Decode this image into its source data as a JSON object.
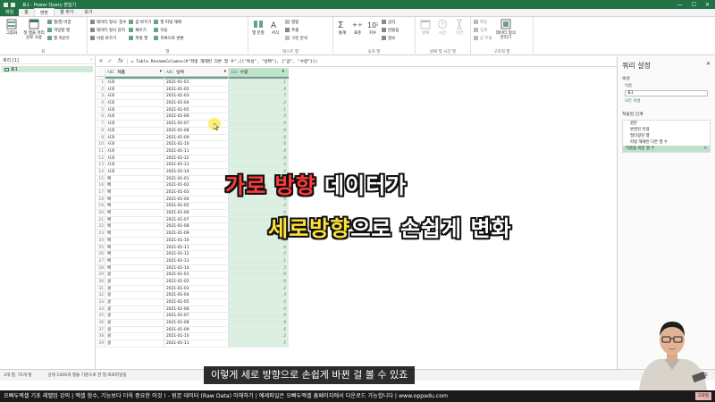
{
  "window": {
    "title": "표1 - Power Query 편집기"
  },
  "tabs": [
    {
      "label": "파일",
      "kind": "file"
    },
    {
      "label": "홈",
      "kind": ""
    },
    {
      "label": "변환",
      "kind": "active"
    },
    {
      "label": "열 추가",
      "kind": ""
    },
    {
      "label": "보기",
      "kind": ""
    }
  ],
  "ribbon": {
    "group_table": {
      "label": "표",
      "big1": "그룹화",
      "big2": "첫 행을 머리글로 사용",
      "small": [
        "행/열 바꿈",
        "역방향 행",
        "행 카운트"
      ]
    },
    "group_anycol": {
      "label": "열",
      "small1": [
        "데이터 형식: 정수",
        "데이터 형식 감지",
        "이름 바꾸기"
      ],
      "small2": [
        "값 바꾸기",
        "채우기",
        "피벗 열"
      ],
      "small3": [
        "열 피벗 해제",
        "이동",
        "목록으로 변환"
      ]
    },
    "group_text": {
      "label": "텍스트 열",
      "big1": "열 분할",
      "big2": "서식",
      "small": [
        "병합",
        "추출",
        "구문 분석"
      ]
    },
    "group_number": {
      "label": "숫자 열",
      "big1": "통계",
      "big2": "표준",
      "big3": "지수",
      "small": [
        "삼각",
        "반올림",
        "정보"
      ]
    },
    "group_datetime": {
      "label": "날짜 및 시간 열",
      "big1": "날짜",
      "big2": "시간",
      "big3": "기간"
    },
    "group_structured": {
      "label": "구조적 열",
      "small": [
        "확장",
        "집계",
        "값 추출"
      ],
      "big1": "데이터 형식 관리기"
    }
  },
  "queries": {
    "header": "쿼리 [1]",
    "items": [
      {
        "label": "표1"
      }
    ]
  },
  "formula": {
    "cancel": "✕",
    "confirm": "✓",
    "fx": "fx",
    "text": "= Table.RenameColumns(#\"피벗 해제된 다른 열 수\",{{\"특성\", \"날짜\"}, {\"값\", \"수량\"}})"
  },
  "grid": {
    "columns": [
      {
        "label": "제품",
        "type": "ABC"
      },
      {
        "label": "날짜",
        "type": "ABC"
      },
      {
        "label": "수량",
        "type": "123"
      }
    ],
    "rows": [
      [
        "1",
        "사과",
        "2021-01-01",
        "1"
      ],
      [
        "2",
        "사과",
        "2021-01-02",
        "6"
      ],
      [
        "3",
        "사과",
        "2021-01-03",
        "7"
      ],
      [
        "4",
        "사과",
        "2021-01-04",
        "2"
      ],
      [
        "5",
        "사과",
        "2021-01-05",
        "1"
      ],
      [
        "6",
        "사과",
        "2021-01-06",
        "3"
      ],
      [
        "7",
        "사과",
        "2021-01-07",
        "9"
      ],
      [
        "8",
        "사과",
        "2021-01-08",
        "9"
      ],
      [
        "9",
        "사과",
        "2021-01-09",
        "8"
      ],
      [
        "10",
        "사과",
        "2021-01-10",
        "6"
      ],
      [
        "11",
        "사과",
        "2021-01-11",
        "4"
      ],
      [
        "12",
        "사과",
        "2021-01-12",
        "8"
      ],
      [
        "13",
        "사과",
        "2021-01-13",
        "3"
      ],
      [
        "14",
        "사과",
        "2021-01-14",
        "9"
      ],
      [
        "15",
        "배",
        "2021-01-01",
        "5"
      ],
      [
        "16",
        "배",
        "2021-01-02",
        "6"
      ],
      [
        "17",
        "배",
        "2021-01-03",
        "9"
      ],
      [
        "18",
        "배",
        "2021-01-04",
        "9"
      ],
      [
        "19",
        "배",
        "2021-01-05",
        "3"
      ],
      [
        "20",
        "배",
        "2021-01-06",
        "6"
      ],
      [
        "21",
        "배",
        "2021-01-07",
        "7"
      ],
      [
        "22",
        "배",
        "2021-01-08",
        "8"
      ],
      [
        "23",
        "배",
        "2021-01-09",
        "6"
      ],
      [
        "24",
        "배",
        "2021-01-10",
        "8"
      ],
      [
        "25",
        "배",
        "2021-01-11",
        "8"
      ],
      [
        "26",
        "배",
        "2021-01-12",
        "5"
      ],
      [
        "27",
        "배",
        "2021-01-13",
        "1"
      ],
      [
        "28",
        "배",
        "2021-01-14",
        "3"
      ],
      [
        "29",
        "귤",
        "2021-01-01",
        "9"
      ],
      [
        "30",
        "귤",
        "2021-01-02",
        "8"
      ],
      [
        "31",
        "귤",
        "2021-01-03",
        "2"
      ],
      [
        "32",
        "귤",
        "2021-01-04",
        "3"
      ],
      [
        "33",
        "귤",
        "2021-01-05",
        "6"
      ],
      [
        "34",
        "귤",
        "2021-01-06",
        "9"
      ],
      [
        "35",
        "귤",
        "2021-01-07",
        "4"
      ],
      [
        "36",
        "귤",
        "2021-01-08",
        "8"
      ],
      [
        "37",
        "귤",
        "2021-01-09",
        "6"
      ],
      [
        "38",
        "귤",
        "2021-01-10",
        "2"
      ],
      [
        "39",
        "귤",
        "2021-01-11",
        "5"
      ]
    ]
  },
  "settings": {
    "title": "쿼리 설정",
    "close": "✕",
    "properties": "속성",
    "name_label": "이름",
    "name_value": "표1",
    "all_props": "모든 속성",
    "steps_title": "적용된 단계",
    "steps": [
      {
        "label": "원본",
        "sel": false
      },
      {
        "label": "변경된 유형",
        "sel": false
      },
      {
        "label": "필터링된 행",
        "sel": false
      },
      {
        "label": "피벗 해제된 다른 열 수",
        "sel": false
      },
      {
        "label": "이름을 바꾼 열 수",
        "sel": true
      }
    ]
  },
  "status": {
    "left": "3개 열, 75개 행",
    "middle": "상위 1000개 행을 기준으로 한 열 프로파일링",
    "right": "오후"
  },
  "overlay": {
    "line1_hl": "가로 방향",
    "line1_rest": " 데이터가",
    "line2_hl": "세로방향",
    "line2_rest": "으로 손쉽게 변화"
  },
  "subtitle": "이렇게 세로 방향으로 손쉽게 바뀐 걸 볼 수 있죠",
  "ticker": {
    "text": "오빠두엑셀 기초 레벨업 강의 | 엑셀 함수, 기능보다 더욱 중요한 이것 ! - 원본 데이터 (Raw Data) 이해하기 | 예제파일은 오빠두엑셀 홈페이지에서 다운로드 가능합니다 | www.oppadu.com",
    "badge": "고화질"
  },
  "colors": {
    "excel_green": "#217346",
    "red_hl": "#ff3a3a",
    "yellow_hl": "#ffe23a"
  }
}
